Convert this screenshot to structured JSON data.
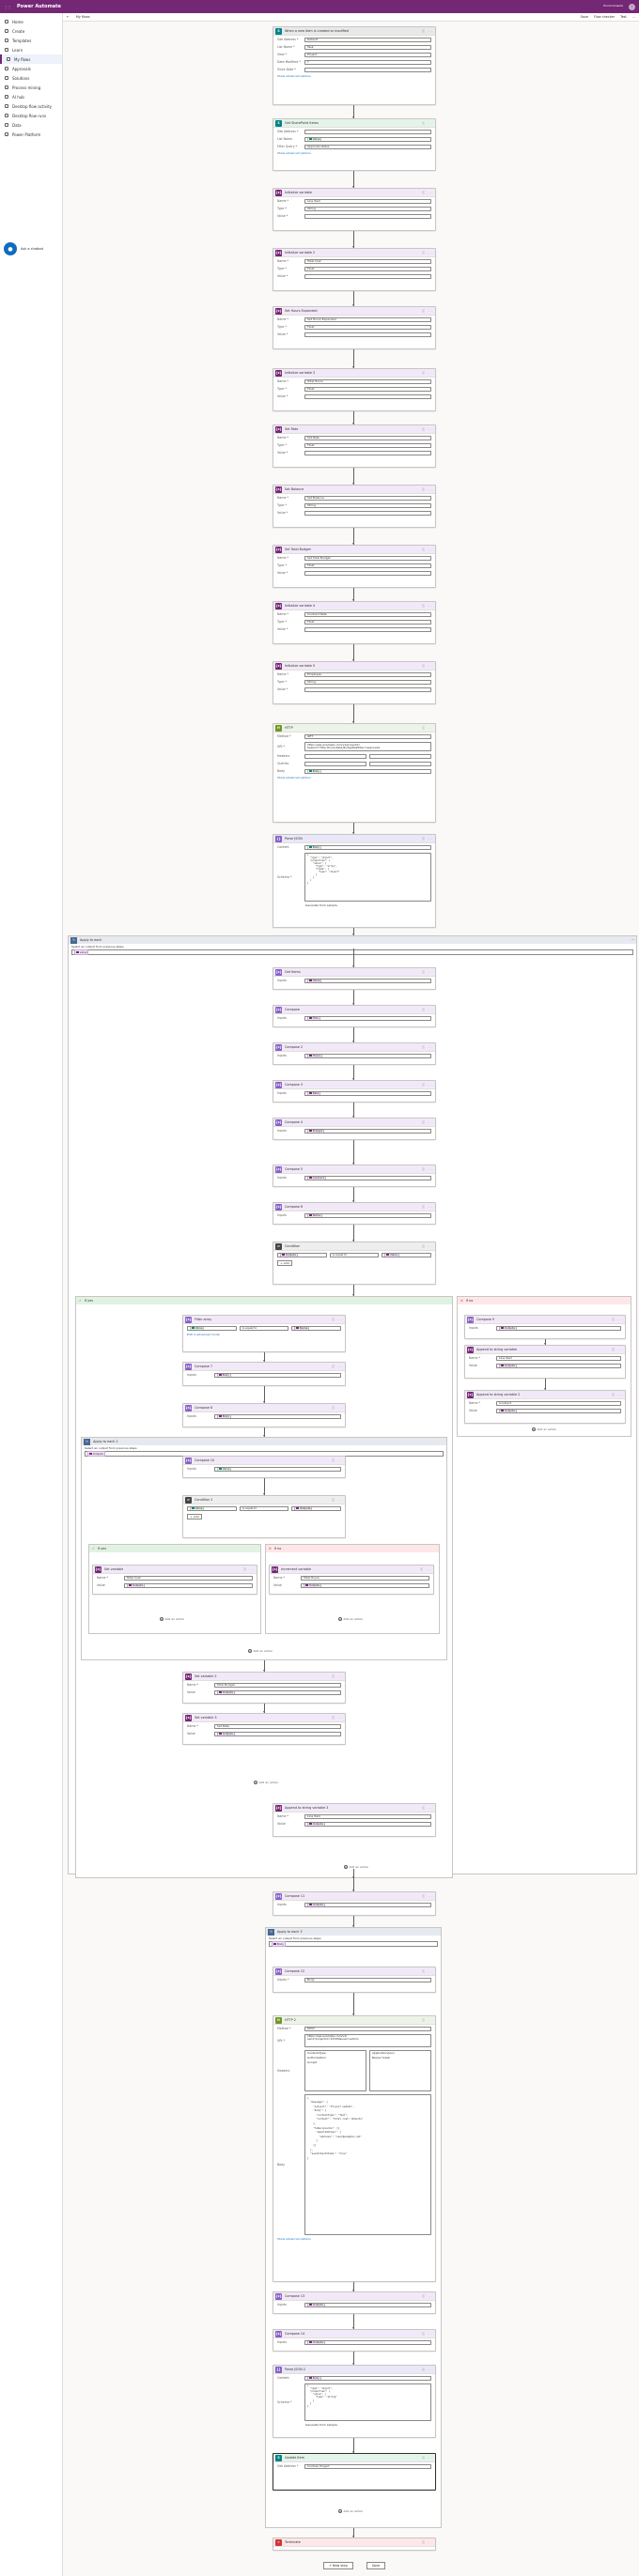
{
  "topbar": {
    "app": "Power Automate",
    "env": "Environments",
    "dot": "?"
  },
  "toolbar": {
    "back": "←",
    "title": "My flows",
    "items": [
      "Save",
      "Flow checker",
      "Test",
      "..."
    ]
  },
  "nav": {
    "items": [
      {
        "label": "Home"
      },
      {
        "label": "Create"
      },
      {
        "label": "Templates"
      },
      {
        "label": "Learn"
      },
      {
        "label": "My flows",
        "selected": true
      },
      {
        "label": "Approvals"
      },
      {
        "label": "Solutions"
      },
      {
        "label": "Process mining"
      },
      {
        "label": "AI hub"
      },
      {
        "label": "Desktop flow activity"
      },
      {
        "label": "Desktop flow runs"
      },
      {
        "label": "Data"
      },
      {
        "label": "Power Platform"
      }
    ],
    "bot_label": "Ask a chatbot",
    "bot_icon": "●"
  },
  "cards": {
    "trigger": {
      "title": "When a new item is created or modified",
      "rows": [
        [
          "Site Address",
          "Default"
        ],
        [
          "List Name",
          "Task"
        ],
        [
          "View",
          "Project"
        ],
        [
          "Date Modified",
          "Y"
        ],
        [
          "Since Date",
          ""
        ]
      ],
      "link": "Show advanced options"
    },
    "getitems": {
      "title": "Get SharePoint Items",
      "rows": [
        [
          "Site Address",
          ""
        ],
        [
          "List Name",
          "Value"
        ],
        [
          "Filter Query",
          "Approval status"
        ]
      ],
      "link": "Show advanced options"
    },
    "iv1": {
      "title": "Initialize variable",
      "rows": [
        [
          "Name",
          "Line Item"
        ],
        [
          "Type",
          "String"
        ],
        [
          "Value",
          ""
        ]
      ]
    },
    "iv2": {
      "title": "Initialize variable 2",
      "rows": [
        [
          "Name",
          "Total Cost"
        ],
        [
          "Type",
          "Float"
        ],
        [
          "Value",
          ""
        ]
      ]
    },
    "iv3": {
      "title": "Set Hours Expended",
      "rows": [
        [
          "Name",
          "Set Hours Expended"
        ],
        [
          "Type",
          "Float"
        ],
        [
          "Value",
          ""
        ]
      ]
    },
    "iv4": {
      "title": "Initialize variable 3",
      "rows": [
        [
          "Name",
          "Total Hours"
        ],
        [
          "Type",
          "Float"
        ],
        [
          "Value",
          ""
        ]
      ]
    },
    "iv5": {
      "title": "Set Rate",
      "rows": [
        [
          "Name",
          "Set Rate"
        ],
        [
          "Type",
          "Float"
        ],
        [
          "Value",
          ""
        ]
      ]
    },
    "iv6": {
      "title": "Set Balance",
      "rows": [
        [
          "Name",
          "Set Balance"
        ],
        [
          "Type",
          "String"
        ],
        [
          "Value",
          ""
        ]
      ]
    },
    "iv7": {
      "title": "Set Total Budget",
      "rows": [
        [
          "Name",
          "Set Total Budget"
        ],
        [
          "Type",
          "Float"
        ],
        [
          "Value",
          ""
        ]
      ]
    },
    "iv8": {
      "title": "Initialize variable 4",
      "rows": [
        [
          "Name",
          "Contract Rate"
        ],
        [
          "Type",
          "Float"
        ],
        [
          "Value",
          ""
        ]
      ]
    },
    "iv9": {
      "title": "Initialize variable 5",
      "rows": [
        [
          "Name",
          "Employee"
        ],
        [
          "Type",
          "String"
        ],
        [
          "Value",
          ""
        ]
      ]
    },
    "http": {
      "title": "HTTP",
      "rows": [
        [
          "Method",
          "GET"
        ],
        [
          "URI",
          "https://api.example.com/v1/projects?\n$select=Title,Hours,Rate,Budget&$filter=Approved"
        ],
        [
          "Headers",
          ""
        ],
        [
          "Queries",
          ""
        ],
        [
          "Body",
          ""
        ]
      ],
      "link": "Show advanced options"
    },
    "parse": {
      "title": "Parse JSON",
      "rows": [
        [
          "Content",
          "Body"
        ],
        [
          "Schema",
          ""
        ]
      ],
      "code": "{\n  \"type\": \"object\",\n  \"properties\": {\n    \"value\": {\n      \"type\": \"array\",\n      \"items\": {\n        \"type\": \"object\"\n      }\n    }\n  }\n}",
      "link": "Generate from sample"
    },
    "loop1": {
      "title": "Apply to each",
      "sel": "Select an output from previous steps",
      "pill": "value"
    },
    "gi2": {
      "title": "Get Items",
      "row": "Value"
    },
    "c1": {
      "title": "Compose",
      "row": "Title"
    },
    "c2": {
      "title": "Compose 2",
      "row": "Hours"
    },
    "c3": {
      "title": "Compose 3",
      "row": "Rate"
    },
    "c4": {
      "title": "Compose 4",
      "row": "Budget"
    },
    "c5": {
      "title": "Compose 5",
      "row": "Contract"
    },
    "c6": {
      "title": "Compose 6",
      "row": "Name"
    },
    "cond1": {
      "title": "Condition",
      "l": "Outputs",
      "op": "is equal to",
      "r": "Value",
      "add": "Add"
    },
    "yes": "If yes",
    "no": "If no",
    "fy": {
      "title": "Filter array",
      "pill1": "Value",
      "op": "is equal to",
      "pill2": "Name",
      "link": "Edit in advanced mode"
    },
    "cy1": {
      "title": "Compose 7",
      "row": "Body"
    },
    "cy2": {
      "title": "Compose 8",
      "row": "Body"
    },
    "no1": {
      "title": "Compose 9",
      "row": "Outputs"
    },
    "no2": {
      "title": "Append to string variable",
      "name": "Line Item",
      "value": "Outputs"
    },
    "no3": {
      "title": "Append to string variable 2",
      "name": "Contract",
      "value": "Outputs"
    },
    "loop2": {
      "title": "Apply to each 2",
      "pill": "Outputs"
    },
    "l2c": {
      "title": "Compose 10",
      "row": "Value"
    },
    "cond2": {
      "title": "Condition 2",
      "l": "Value",
      "op": "is equal to",
      "r": "Outputs",
      "add": "Add"
    },
    "ny1": {
      "title": "Set variable",
      "name": "Total Cost",
      "value": "Outputs"
    },
    "nn1": {
      "title": "Increment variable",
      "name": "Total Hours",
      "value": "Outputs"
    },
    "sv1": {
      "title": "Set variable 2",
      "name": "Total Budget",
      "value": "Outputs"
    },
    "sv2": {
      "title": "Set variable 3",
      "name": "Set Rate",
      "value": "Outputs"
    },
    "ap": {
      "title": "Append to string variable 3",
      "name": "Line Item",
      "value": "Outputs"
    },
    "c11": {
      "title": "Compose 11",
      "row": "Outputs"
    },
    "loop3": {
      "title": "Apply to each 3",
      "pill": "Body"
    },
    "c12": {
      "title": "Compose 12",
      "rows": [
        [
          "Inputs",
          "Body"
        ]
      ]
    },
    "http2": {
      "title": "HTTP 2",
      "rows": [
        [
          "Method",
          "POST"
        ],
        [
          "URI",
          "https://api.example.com/v1/\nsend?projectid=12345&user=admin"
        ],
        [
          "Headers",
          ""
        ]
      ],
      "dd": [
        "Content-Type",
        "application/json",
        "Authorization",
        "Bearer token",
        "Accept"
      ],
      "body": "{\n  \"message\": {\n    \"subject\": \"Project update\",\n    \"body\": {\n      \"contentType\": \"Text\",\n      \"content\": \"Total cost: Outputs\"\n    },\n    \"toRecipients\": [{\n      \"emailAddress\": {\n        \"address\": \"user@example.com\"\n      }\n    }]\n  },\n  \"saveToSentItems\": \"true\"\n}",
      "link": "Show advanced options"
    },
    "c13": {
      "title": "Compose 13",
      "row": "Outputs"
    },
    "c14": {
      "title": "Compose 14",
      "row": "Outputs"
    },
    "parse2": {
      "title": "Parse JSON 2",
      "rows": [
        [
          "Content",
          "Body"
        ],
        [
          "Schema",
          ""
        ]
      ],
      "code": "{\n  \"type\": \"object\",\n  \"properties\": {\n    \"value\": {\n      \"type\": \"string\"\n    }\n  }\n}",
      "link": "Generate from sample"
    },
    "upd": {
      "title": "Update item",
      "rows": [
        [
          "Site Address",
          "Contoso Project"
        ]
      ]
    },
    "term": {
      "title": "Terminate"
    }
  },
  "add_action": "Add an action",
  "bottom": {
    "new": "+ New step",
    "save": "Save"
  }
}
